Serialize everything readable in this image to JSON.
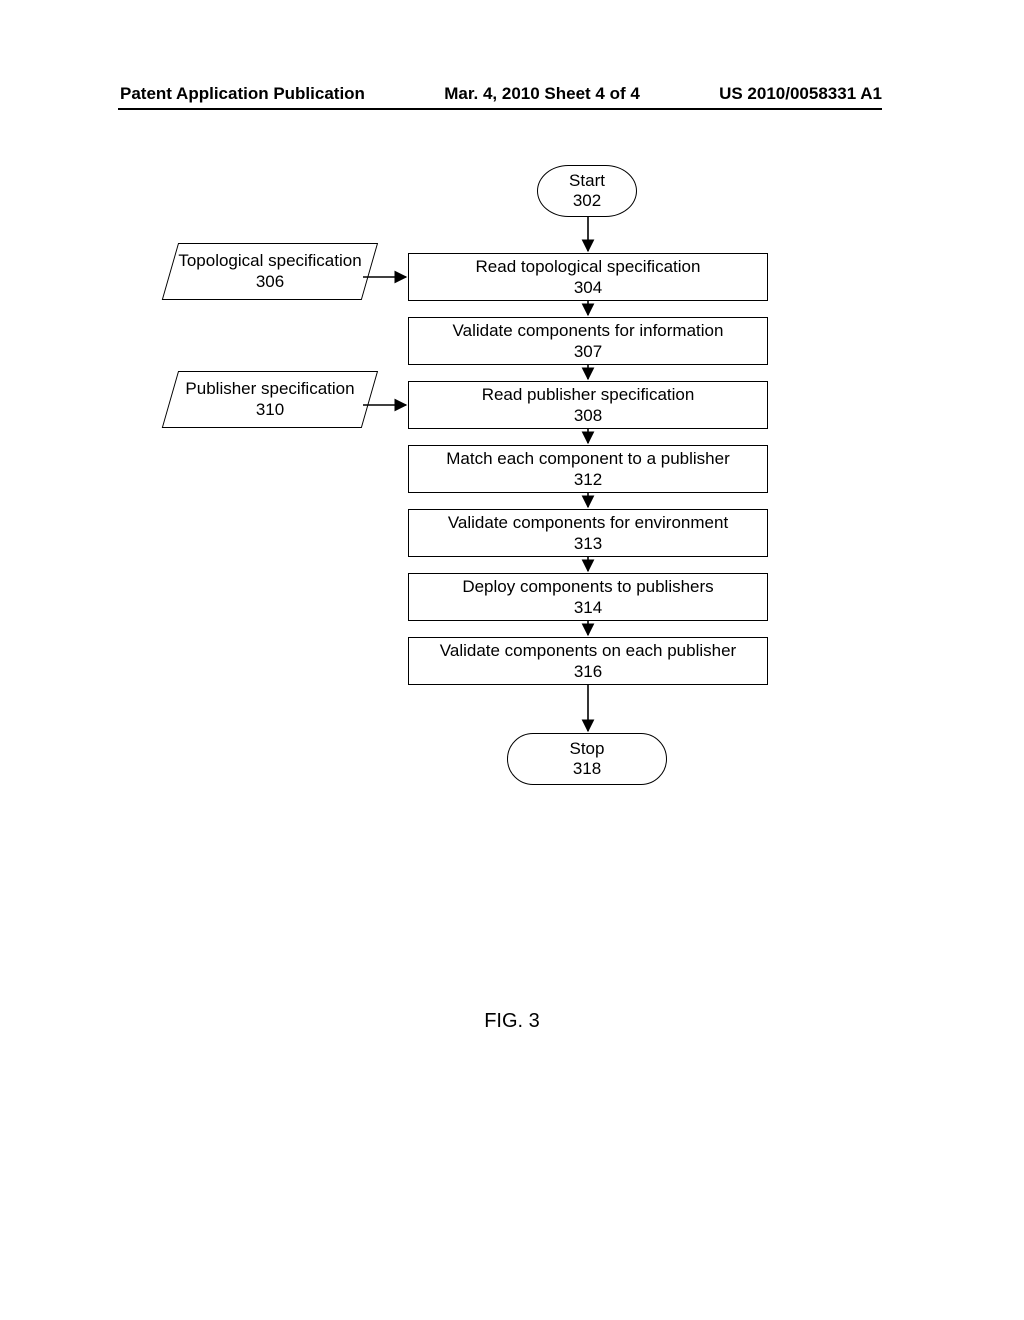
{
  "header": {
    "left": "Patent Application Publication",
    "center": "Mar. 4, 2010  Sheet 4 of 4",
    "right": "US 2010/0058331 A1"
  },
  "flowchart": {
    "start": {
      "label": "Start",
      "num": "302"
    },
    "stop": {
      "label": "Stop",
      "num": "318"
    },
    "steps": [
      {
        "label": "Read topological specification",
        "num": "304"
      },
      {
        "label": "Validate components for information",
        "num": "307"
      },
      {
        "label": "Read publisher specification",
        "num": "308"
      },
      {
        "label": "Match each component to a publisher",
        "num": "312"
      },
      {
        "label": "Validate components for environment",
        "num": "313"
      },
      {
        "label": "Deploy components to publishers",
        "num": "314"
      },
      {
        "label": "Validate components on each publisher",
        "num": "316"
      }
    ],
    "inputs": [
      {
        "label": "Topological specification",
        "num": "306"
      },
      {
        "label": "Publisher specification",
        "num": "310"
      }
    ]
  },
  "figure_label": "FIG. 3"
}
